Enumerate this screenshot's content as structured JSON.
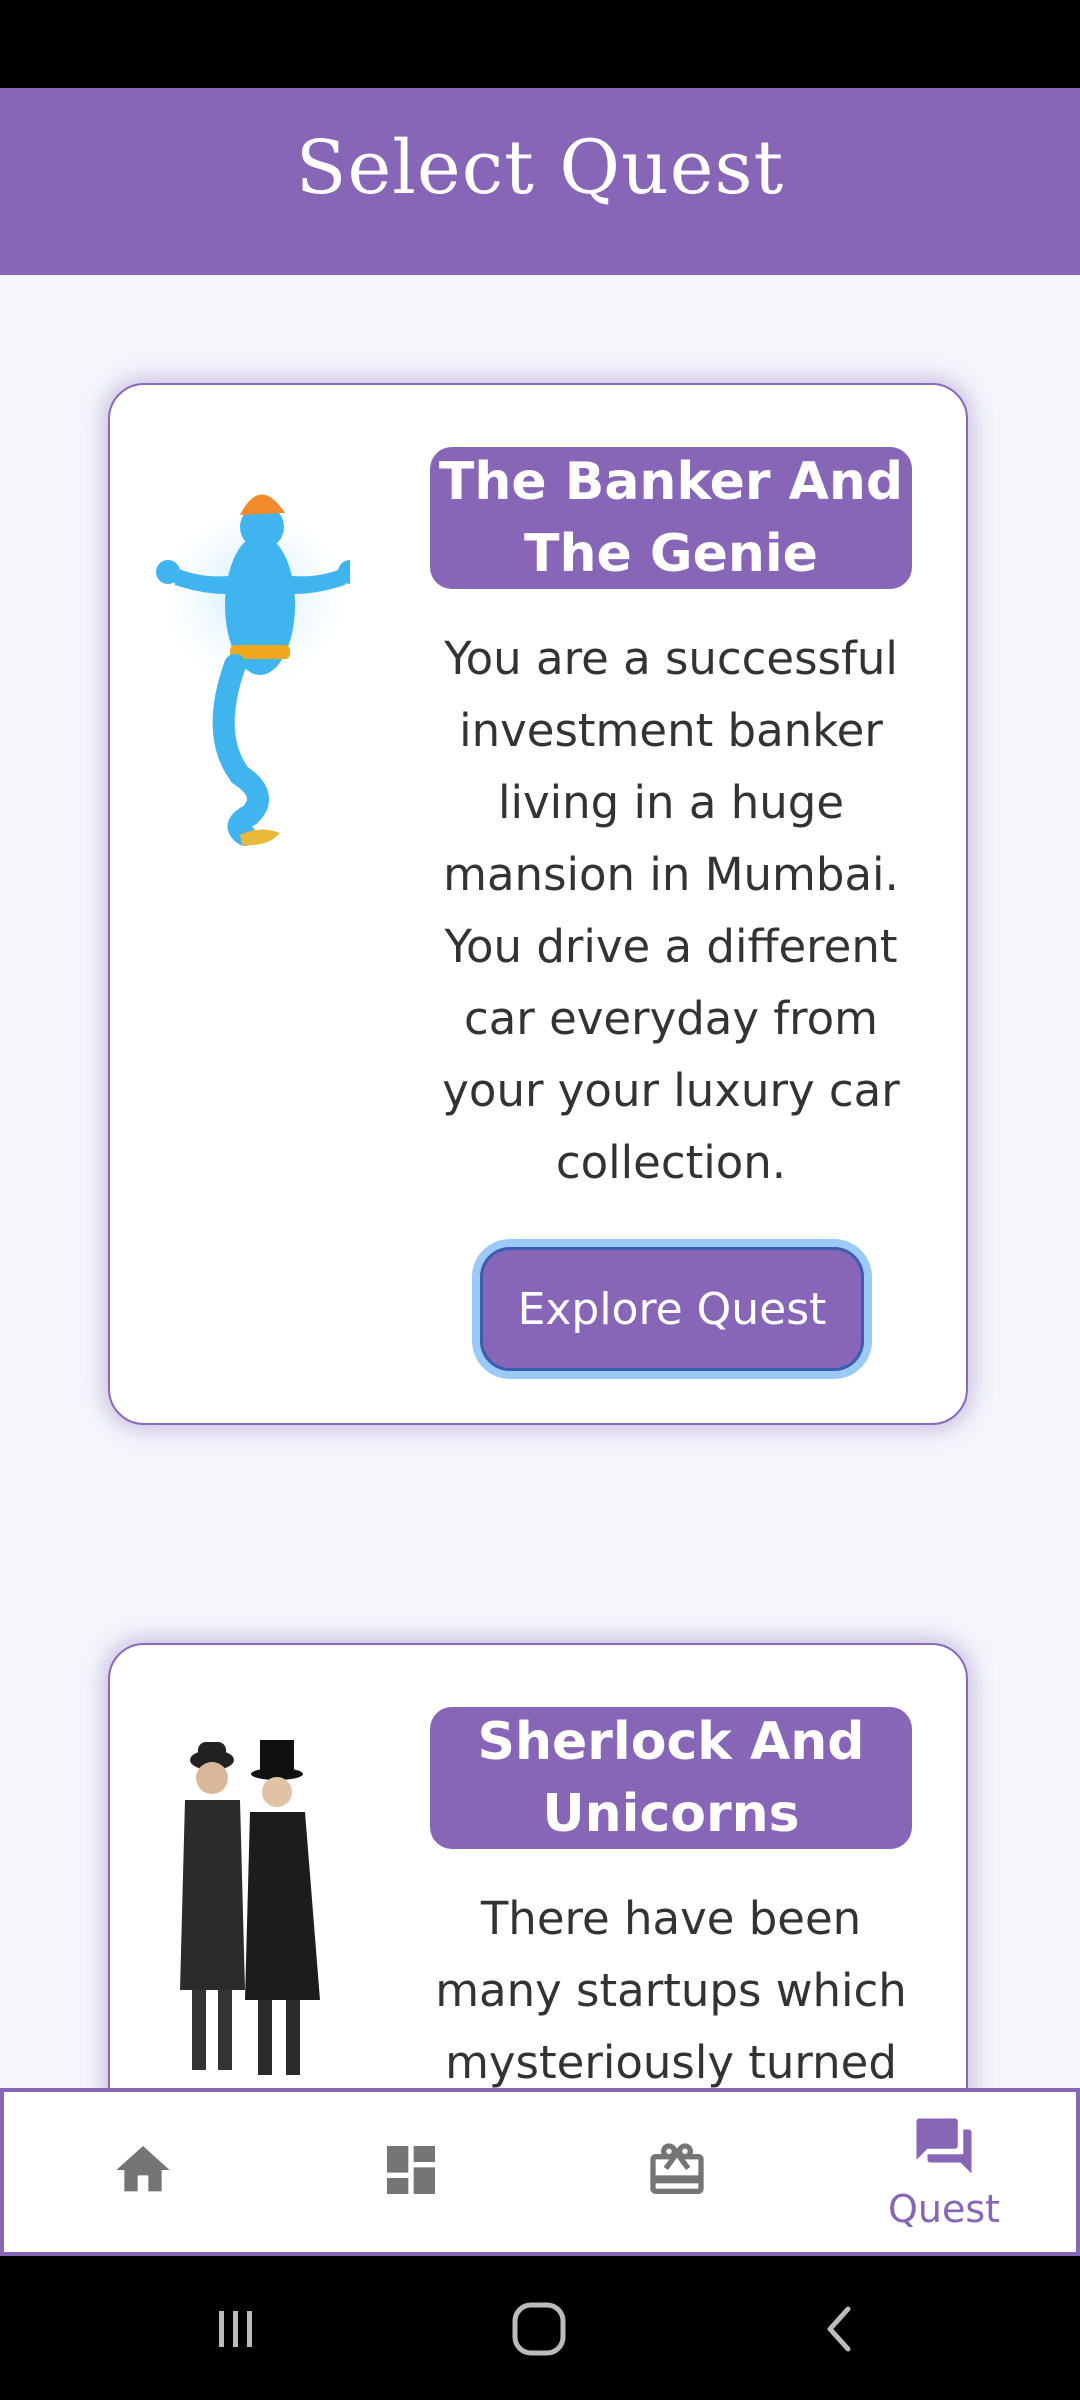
{
  "header": {
    "title": "Select Quest"
  },
  "quests": [
    {
      "title": "The Banker And The Genie",
      "description": "You are a successful investment banker living in a huge mansion in Mumbai. You drive a different car everyday from your your luxury car collection.",
      "button_label": "Explore Quest",
      "image_icon": "genie-icon"
    },
    {
      "title": "Sherlock And Unicorns",
      "description": "There have been many startups which mysteriously turned",
      "image_icon": "detectives-icon"
    }
  ],
  "nav": {
    "items": [
      {
        "icon": "home-icon",
        "label": ""
      },
      {
        "icon": "dashboard-icon",
        "label": ""
      },
      {
        "icon": "gift-card-icon",
        "label": ""
      },
      {
        "icon": "chat-icon",
        "label": "Quest",
        "active": true
      }
    ]
  },
  "colors": {
    "primary": "#8766b8",
    "background": "#f4f6fb",
    "focus": "#9bcaf6"
  }
}
